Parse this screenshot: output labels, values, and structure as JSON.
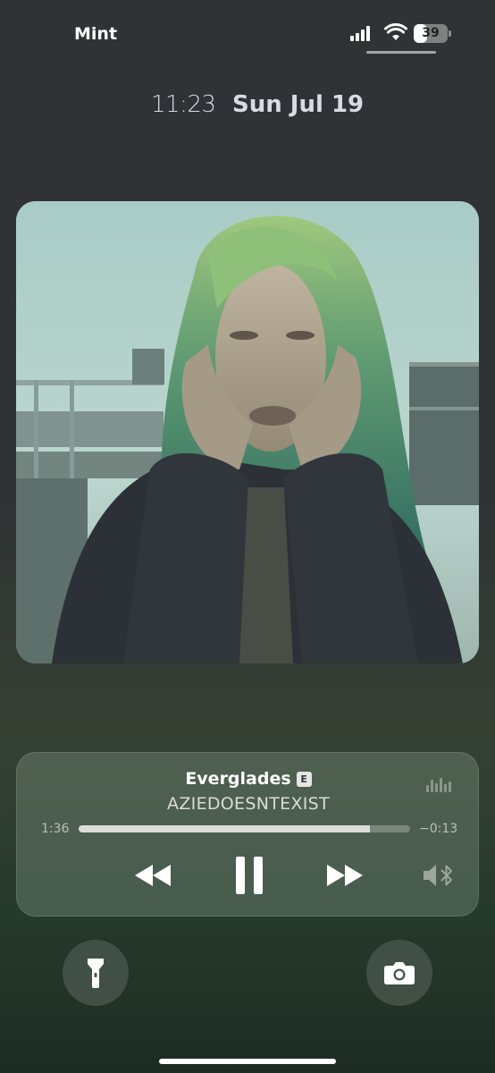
{
  "status": {
    "carrier": "Mint",
    "battery": "39",
    "battery_level": 0.39
  },
  "lock": {
    "time": "11:23",
    "date": "Sun Jul 19"
  },
  "now_playing": {
    "title": "Everglades",
    "explicit": "E",
    "artist": "AZIEDOESNTEXIST",
    "elapsed": "1:36",
    "remaining": "−0:13",
    "progress": 0.88
  },
  "icons": {
    "signal": "cellular-signal-icon",
    "wifi": "wifi-icon",
    "waveform": "audio-waveform-icon",
    "rewind": "rewind-icon",
    "pause": "pause-icon",
    "forward": "fast-forward-icon",
    "output": "bluetooth-speaker-icon",
    "flashlight": "flashlight-icon",
    "camera": "camera-icon"
  }
}
